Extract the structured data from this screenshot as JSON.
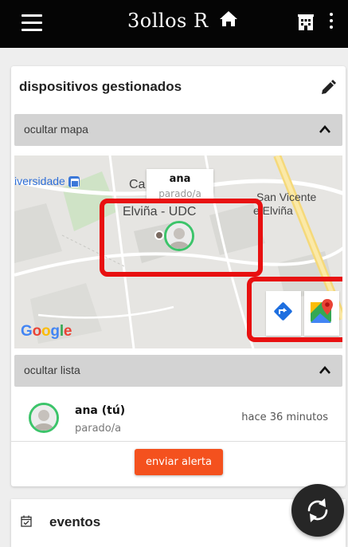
{
  "topbar": {
    "title": "3ollos R",
    "menu_icon": "hamburger-menu-icon",
    "home_icon": "home-icon",
    "building_icon": "building-icon",
    "more_icon": "more-vert-icon"
  },
  "devices_card": {
    "title": "dispositivos gestionados",
    "edit_icon": "pencil-icon",
    "map_toggle": {
      "label": "ocultar mapa",
      "icon": "chevron-up-icon"
    },
    "map": {
      "labels": {
        "universidade": "iversidade",
        "campus_partial": "Ca",
        "elvina_udc": "Elviña - UDC",
        "san_vicente_1": "San Vicente",
        "san_vicente_2": "e Elviña"
      },
      "popup": {
        "name": "ana",
        "status": "parado/a"
      },
      "google_logo": "Google",
      "buttons": [
        "directions-icon",
        "google-maps-icon"
      ]
    },
    "list_toggle": {
      "label": "ocultar lista",
      "icon": "chevron-up-icon"
    },
    "list": [
      {
        "name": "ana (tú)",
        "status": "parado/a",
        "time": "hace 36 minutos"
      }
    ],
    "alert_button": "enviar alerta"
  },
  "events_card": {
    "title": "eventos",
    "icon": "calendar-check-icon"
  },
  "fab": {
    "icon": "refresh-icon"
  },
  "colors": {
    "topbar": "#050505",
    "accent": "#f4511e",
    "avatar_border": "#3cc46a",
    "highlight": "#e81010",
    "fab": "#262626"
  }
}
